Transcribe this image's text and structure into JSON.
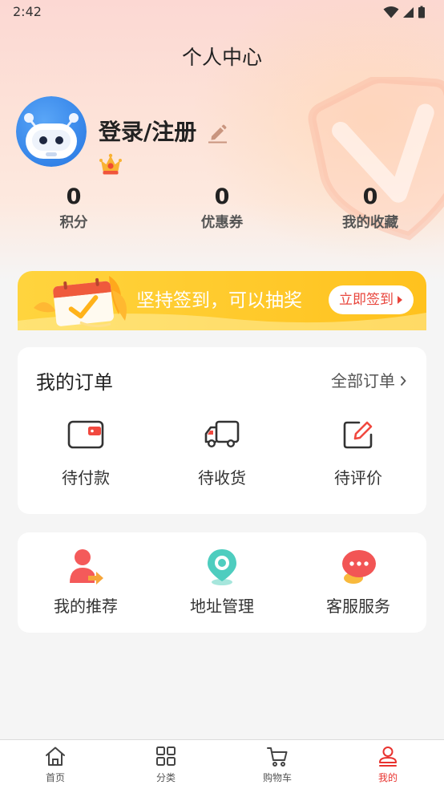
{
  "status_bar": {
    "time": "2:42",
    "icons": [
      "wifi-icon",
      "signal-icon",
      "battery-icon"
    ]
  },
  "header": {
    "title": "个人中心"
  },
  "profile": {
    "login_label": "登录/注册",
    "avatar_icon": "robot-avatar",
    "badge_icon": "crown-icon"
  },
  "stats": [
    {
      "value": "0",
      "label": "积分"
    },
    {
      "value": "0",
      "label": "优惠券"
    },
    {
      "value": "0",
      "label": "我的收藏"
    }
  ],
  "signin_banner": {
    "text": "坚持签到，可以抽奖",
    "button_label": "立即签到"
  },
  "orders": {
    "title": "我的订单",
    "all_label": "全部订单",
    "items": [
      {
        "label": "待付款",
        "icon": "wallet-icon"
      },
      {
        "label": "待收货",
        "icon": "truck-icon"
      },
      {
        "label": "待评价",
        "icon": "review-icon"
      }
    ]
  },
  "services": {
    "items": [
      {
        "label": "我的推荐",
        "icon": "referral-icon"
      },
      {
        "label": "地址管理",
        "icon": "location-icon"
      },
      {
        "label": "客服服务",
        "icon": "customer-service-icon"
      }
    ]
  },
  "bottom_nav": {
    "items": [
      {
        "label": "首页",
        "icon": "home-icon",
        "active": false
      },
      {
        "label": "分类",
        "icon": "category-icon",
        "active": false
      },
      {
        "label": "购物车",
        "icon": "cart-icon",
        "active": false
      },
      {
        "label": "我的",
        "icon": "profile-icon",
        "active": true
      }
    ]
  },
  "colors": {
    "accent": "#e8332f",
    "banner": "#ffca2c",
    "banner_button_text": "#e8453c",
    "location_teal": "#4ecdbf",
    "page_background": "#f5f5f5",
    "header_gradient_top": "#fcd8d3"
  }
}
